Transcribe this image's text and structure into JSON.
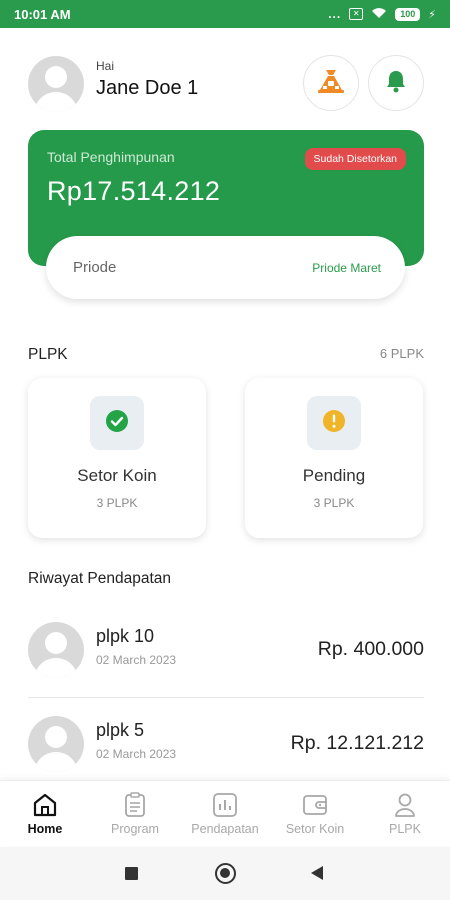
{
  "status_bar": {
    "time": "10:01 AM",
    "dots": "...",
    "battery": "100",
    "sim_icon": "x-box-icon",
    "wifi_icon": "wifi-icon",
    "charging_icon": "bolt-icon"
  },
  "header": {
    "greeting": "Hai",
    "user_name": "Jane Doe 1",
    "program_button_icon": "coin-bag-icon",
    "notification_button_icon": "bell-icon"
  },
  "total_card": {
    "label": "Total Penghimpunan",
    "amount": "Rp17.514.212",
    "status_badge": "Sudah Disetorkan",
    "period_label": "Priode",
    "period_value": "Priode Maret"
  },
  "plpk": {
    "title": "PLPK",
    "count": "6 PLPK",
    "cards": [
      {
        "title": "Setor Koin",
        "count": "3 PLPK",
        "icon": "check-circle-icon"
      },
      {
        "title": "Pending",
        "count": "3 PLPK",
        "icon": "exclamation-circle-icon"
      }
    ]
  },
  "history": {
    "title": "Riwayat Pendapatan",
    "items": [
      {
        "name": "plpk 10",
        "date": "02 March 2023",
        "amount": "Rp. 400.000"
      },
      {
        "name": "plpk 5",
        "date": "02 March 2023",
        "amount": "Rp. 12.121.212"
      }
    ]
  },
  "bottom_nav": {
    "active": "Home",
    "items": [
      {
        "label": "Home",
        "icon": "home-icon"
      },
      {
        "label": "Program",
        "icon": "clipboard-icon"
      },
      {
        "label": "Pendapatan",
        "icon": "bar-chart-icon"
      },
      {
        "label": "Setor Koin",
        "icon": "wallet-icon"
      },
      {
        "label": "PLPK",
        "icon": "person-icon"
      }
    ]
  },
  "colors": {
    "brand_green": "#269a4b",
    "badge_red": "#e24b4b",
    "pending_yellow": "#f0b429",
    "check_green": "#22a447"
  }
}
